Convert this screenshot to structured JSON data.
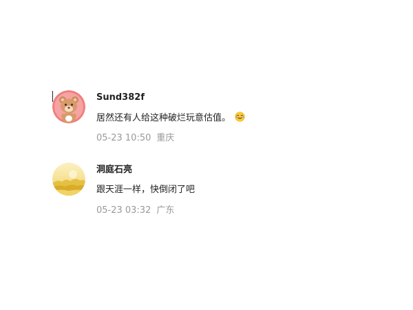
{
  "comments": [
    {
      "username": "Sund382f",
      "text": "居然还有人给这种破烂玩意估值。",
      "emoji_icon": "laughing-crying-emoji",
      "time": "05-23 10:50",
      "location": "重庆",
      "avatar_icon": "cartoon-bear-avatar",
      "avatar_color": "#f07f7f"
    },
    {
      "username": "洞庭石亮",
      "text": "跟天涯一样，快倒闭了吧",
      "time": "05-23 03:32",
      "location": "广东",
      "avatar_icon": "landscape-avatar",
      "avatar_color": "#f2d56a"
    }
  ],
  "colors": {
    "text": "#222222",
    "meta": "#999999",
    "background": "#ffffff"
  }
}
